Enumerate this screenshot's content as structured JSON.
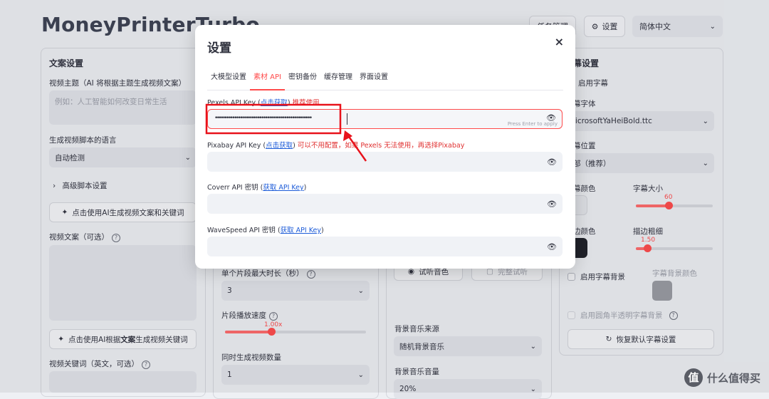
{
  "app": {
    "title": "MoneyPrinterTurbo"
  },
  "topbar": {
    "task_label": "任务管理",
    "settings_label": "设置",
    "lang_value": "简体中文"
  },
  "left": {
    "title": "文案设置",
    "topic_label": "视频主题（AI 将根据主题生成视频文案）",
    "topic_placeholder": "例如：人工智能如何改变日常生活",
    "lang_label": "生成视频脚本的语言",
    "lang_value": "自动检测",
    "advanced_label": "高级脚本设置",
    "gen_script_btn": "点击使用AI生成视频文案和关键词",
    "script_label": "视频文案（可选）",
    "gen_keywords_btn_prefix": "点击使用AI根据",
    "gen_keywords_btn_bold": "文案",
    "gen_keywords_btn_suffix": "生成视频关键词",
    "keywords_label": "视频关键词（英文，可选）"
  },
  "middle": {
    "max_clip_label": "单个片段最大时长（秒）",
    "max_clip_value": "3",
    "speed_label": "片段播放速度",
    "speed_value": "1.00x",
    "speed_fraction": 0.33,
    "concurrent_label": "同时生成视频数量",
    "concurrent_value": "1"
  },
  "audio": {
    "preview_btn": "试听音色",
    "full_preview_btn": "完整试听",
    "bgm_source_label": "背景音乐来源",
    "bgm_source_value": "随机背景音乐",
    "bgm_volume_label": "背景音乐音量",
    "bgm_volume_value": "20%"
  },
  "subtitle": {
    "title": "幕设置",
    "enable_label": "启用字幕",
    "font_label": "幕字体",
    "font_value": "licrosoftYaHeiBold.ttc",
    "position_label": "幕位置",
    "position_value": "部（推荐）",
    "color_label": "幕颜色",
    "size_label": "字幕大小",
    "size_value": "60",
    "size_fraction": 0.43,
    "stroke_color_label": "边颜色",
    "stroke_width_label": "描边粗细",
    "stroke_width_value": "1.50",
    "stroke_fraction": 0.15,
    "bg_enable_label": "启用字幕背景",
    "bg_color_label": "字幕背景颜色",
    "rounded_bg_label": "启用圆角半透明字幕背景",
    "reset_btn": "恢复默认字幕设置",
    "colors": {
      "stroke": "#1f2129",
      "bg": "#9a9ca2"
    }
  },
  "modal": {
    "title": "设置",
    "close": "×",
    "tabs": [
      "大模型设置",
      "素材 API",
      "密钥备份",
      "缓存管理",
      "界面设置"
    ],
    "active_tab": 1,
    "pexels": {
      "label": "Pexels API Key (",
      "link": "点击获取",
      "label_end": ")",
      "note": " 推荐使用",
      "value": "••••••••••••••••••••••••••••••••••••••••••••••••••",
      "hint": "Press Enter to apply"
    },
    "pixabay": {
      "label": "Pixabay API Key (",
      "link": "点击获取",
      "label_end": ")",
      "note": " 可以不用配置，如果 Pexels 无法使用，再选择Pixabay"
    },
    "coverr": {
      "label": "Coverr API 密钥 (",
      "link": "获取 API Key",
      "label_end": ")"
    },
    "wavespeed": {
      "label": "WaveSpeed API 密钥 (",
      "link": "获取 API Key",
      "label_end": ")"
    }
  },
  "watermark": {
    "logo": "值",
    "text": "什么值得买"
  },
  "colors": {
    "accent": "#ff4b4b",
    "link": "#1c5bd8"
  }
}
